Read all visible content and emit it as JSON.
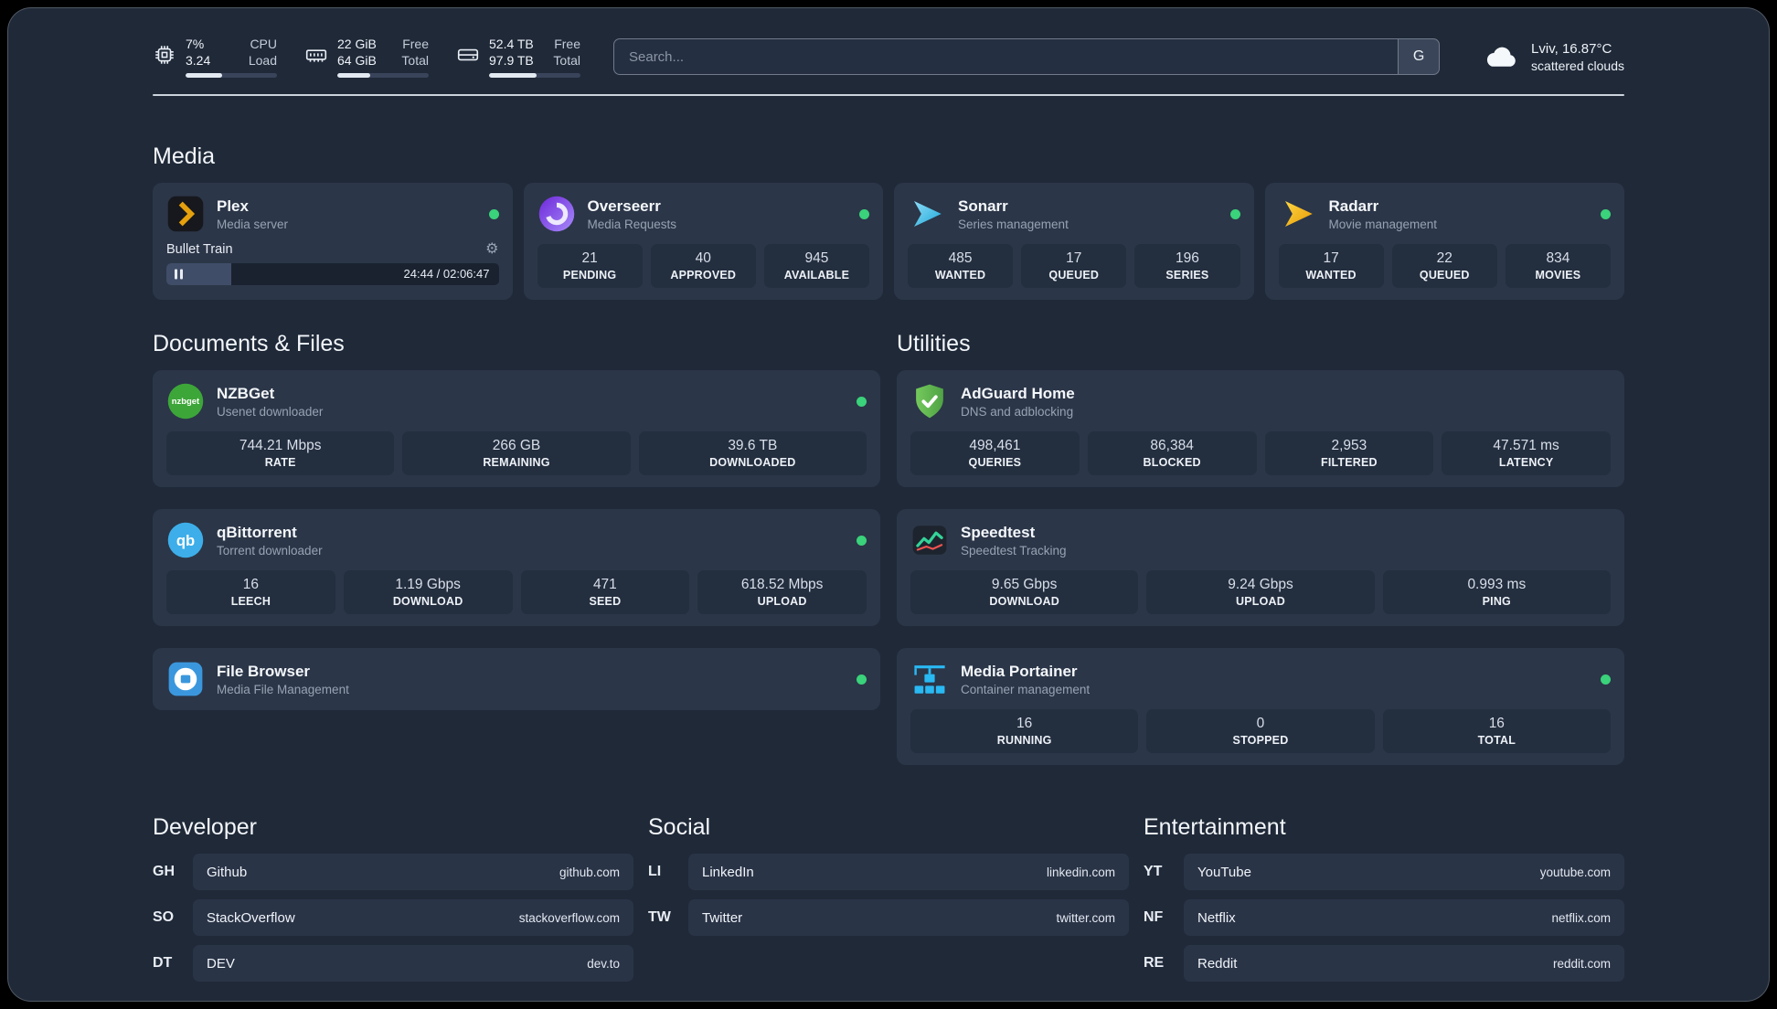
{
  "colors": {
    "background": "#1f2938",
    "card": "#2b3648",
    "stat_tile": "#232e3f",
    "status_green": "#3ad27a",
    "plex_orange": "#e5a00d",
    "sonarr_blue": "#35c5f4",
    "radarr_amber": "#f7b500",
    "nzbget_green": "#3da639",
    "qbittorrent_blue": "#3daee9",
    "filebrowser_blue": "#3b97dd",
    "adguard_green": "#68bd49",
    "portainer_blue": "#29b9f3",
    "speedtest_green": "#34d399"
  },
  "topbar": {
    "metrics": [
      {
        "value_top": "7%",
        "label_top": "CPU",
        "value_bottom": "3.24",
        "label_bottom": "Load",
        "progress_pct": 40
      },
      {
        "value_top": "22 GiB",
        "label_top": "Free",
        "value_bottom": "64 GiB",
        "label_bottom": "Total",
        "progress_pct": 36
      },
      {
        "value_top": "52.4 TB",
        "label_top": "Free",
        "value_bottom": "97.9 TB",
        "label_bottom": "Total",
        "progress_pct": 52
      }
    ],
    "search": {
      "placeholder": "Search...",
      "engine_button": "G"
    },
    "weather": {
      "location": "Lviv, 16.87°C",
      "condition": "scattered clouds"
    }
  },
  "sections": {
    "media": {
      "title": "Media",
      "apps": [
        {
          "name": "Plex",
          "subtitle": "Media server",
          "online": true,
          "player": {
            "track": "Bullet Train",
            "time": "24:44 / 02:06:47",
            "progress_pct": 19.6
          }
        },
        {
          "name": "Overseerr",
          "subtitle": "Media Requests",
          "online": true,
          "stats": [
            {
              "value": "21",
              "label": "PENDING"
            },
            {
              "value": "40",
              "label": "APPROVED"
            },
            {
              "value": "945",
              "label": "AVAILABLE"
            }
          ]
        },
        {
          "name": "Sonarr",
          "subtitle": "Series management",
          "online": true,
          "stats": [
            {
              "value": "485",
              "label": "WANTED"
            },
            {
              "value": "17",
              "label": "QUEUED"
            },
            {
              "value": "196",
              "label": "SERIES"
            }
          ]
        },
        {
          "name": "Radarr",
          "subtitle": "Movie management",
          "online": true,
          "stats": [
            {
              "value": "17",
              "label": "WANTED"
            },
            {
              "value": "22",
              "label": "QUEUED"
            },
            {
              "value": "834",
              "label": "MOVIES"
            }
          ]
        }
      ]
    },
    "documents": {
      "title": "Documents & Files",
      "apps": [
        {
          "name": "NZBGet",
          "subtitle": "Usenet downloader",
          "online": true,
          "stats": [
            {
              "value": "744.21 Mbps",
              "label": "RATE"
            },
            {
              "value": "266 GB",
              "label": "REMAINING"
            },
            {
              "value": "39.6 TB",
              "label": "DOWNLOADED"
            }
          ]
        },
        {
          "name": "qBittorrent",
          "subtitle": "Torrent downloader",
          "online": true,
          "stats": [
            {
              "value": "16",
              "label": "LEECH"
            },
            {
              "value": "1.19 Gbps",
              "label": "DOWNLOAD"
            },
            {
              "value": "471",
              "label": "SEED"
            },
            {
              "value": "618.52 Mbps",
              "label": "UPLOAD"
            }
          ]
        },
        {
          "name": "File Browser",
          "subtitle": "Media File Management",
          "online": true
        }
      ]
    },
    "utilities": {
      "title": "Utilities",
      "apps": [
        {
          "name": "AdGuard Home",
          "subtitle": "DNS and adblocking",
          "online": false,
          "stats": [
            {
              "value": "498,461",
              "label": "QUERIES"
            },
            {
              "value": "86,384",
              "label": "BLOCKED"
            },
            {
              "value": "2,953",
              "label": "FILTERED"
            },
            {
              "value": "47.571 ms",
              "label": "LATENCY"
            }
          ]
        },
        {
          "name": "Speedtest",
          "subtitle": "Speedtest Tracking",
          "online": false,
          "stats": [
            {
              "value": "9.65 Gbps",
              "label": "DOWNLOAD"
            },
            {
              "value": "9.24 Gbps",
              "label": "UPLOAD"
            },
            {
              "value": "0.993 ms",
              "label": "PING"
            }
          ]
        },
        {
          "name": "Media Portainer",
          "subtitle": "Container management",
          "online": true,
          "stats": [
            {
              "value": "16",
              "label": "RUNNING"
            },
            {
              "value": "0",
              "label": "STOPPED"
            },
            {
              "value": "16",
              "label": "TOTAL"
            }
          ]
        }
      ]
    }
  },
  "bookmarks": {
    "developer": {
      "title": "Developer",
      "links": [
        {
          "abbr": "GH",
          "name": "Github",
          "url": "github.com"
        },
        {
          "abbr": "SO",
          "name": "StackOverflow",
          "url": "stackoverflow.com"
        },
        {
          "abbr": "DT",
          "name": "DEV",
          "url": "dev.to"
        }
      ]
    },
    "social": {
      "title": "Social",
      "links": [
        {
          "abbr": "LI",
          "name": "LinkedIn",
          "url": "linkedin.com"
        },
        {
          "abbr": "TW",
          "name": "Twitter",
          "url": "twitter.com"
        }
      ]
    },
    "entertainment": {
      "title": "Entertainment",
      "links": [
        {
          "abbr": "YT",
          "name": "YouTube",
          "url": "youtube.com"
        },
        {
          "abbr": "NF",
          "name": "Netflix",
          "url": "netflix.com"
        },
        {
          "abbr": "RE",
          "name": "Reddit",
          "url": "reddit.com"
        }
      ]
    }
  }
}
